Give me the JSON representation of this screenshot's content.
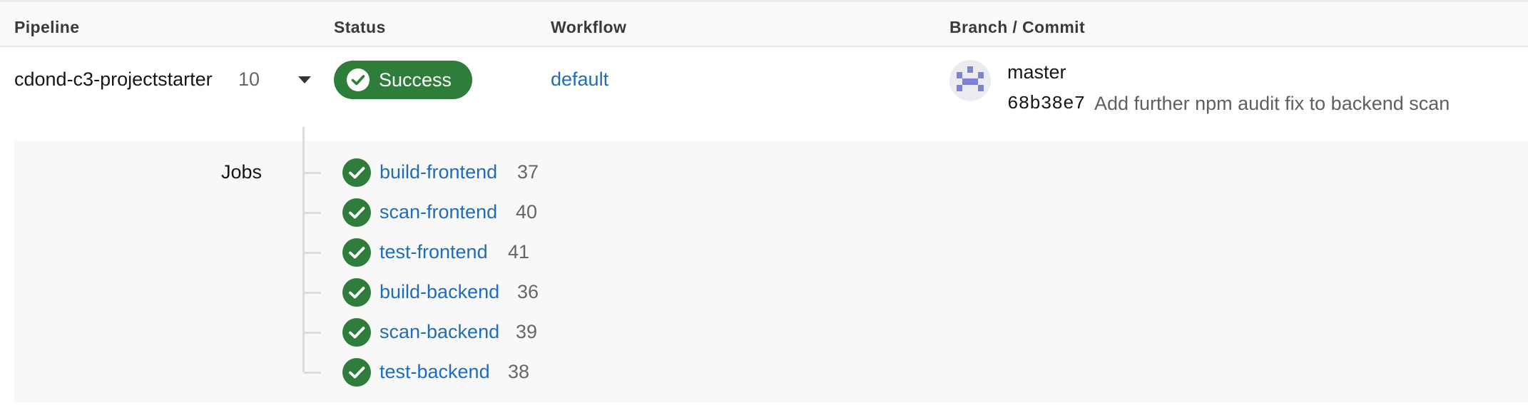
{
  "table": {
    "headers": {
      "pipeline": "Pipeline",
      "status": "Status",
      "workflow": "Workflow",
      "branch_commit": "Branch / Commit"
    }
  },
  "pipeline": {
    "name": "cdond-c3-projectstarter",
    "number": "10",
    "status": "Success",
    "workflow": "default",
    "branch": "master",
    "commit_sha": "68b38e7",
    "commit_message": "Add further npm audit fix to backend scan"
  },
  "jobs": {
    "label": "Jobs",
    "items": [
      {
        "name": "build-frontend",
        "number": "37",
        "status": "success"
      },
      {
        "name": "scan-frontend",
        "number": "40",
        "status": "success"
      },
      {
        "name": "test-frontend",
        "number": "41",
        "status": "success"
      },
      {
        "name": "build-backend",
        "number": "36",
        "status": "success"
      },
      {
        "name": "scan-backend",
        "number": "39",
        "status": "success"
      },
      {
        "name": "test-backend",
        "number": "38",
        "status": "success"
      }
    ]
  },
  "colors": {
    "success": "#2e7d3b",
    "link": "#1f6dba",
    "avatar_identicon": "#7c82d6"
  },
  "icons": {
    "status": "check-circle-icon",
    "expand": "caret-down-icon",
    "avatar": "identicon-avatar"
  }
}
